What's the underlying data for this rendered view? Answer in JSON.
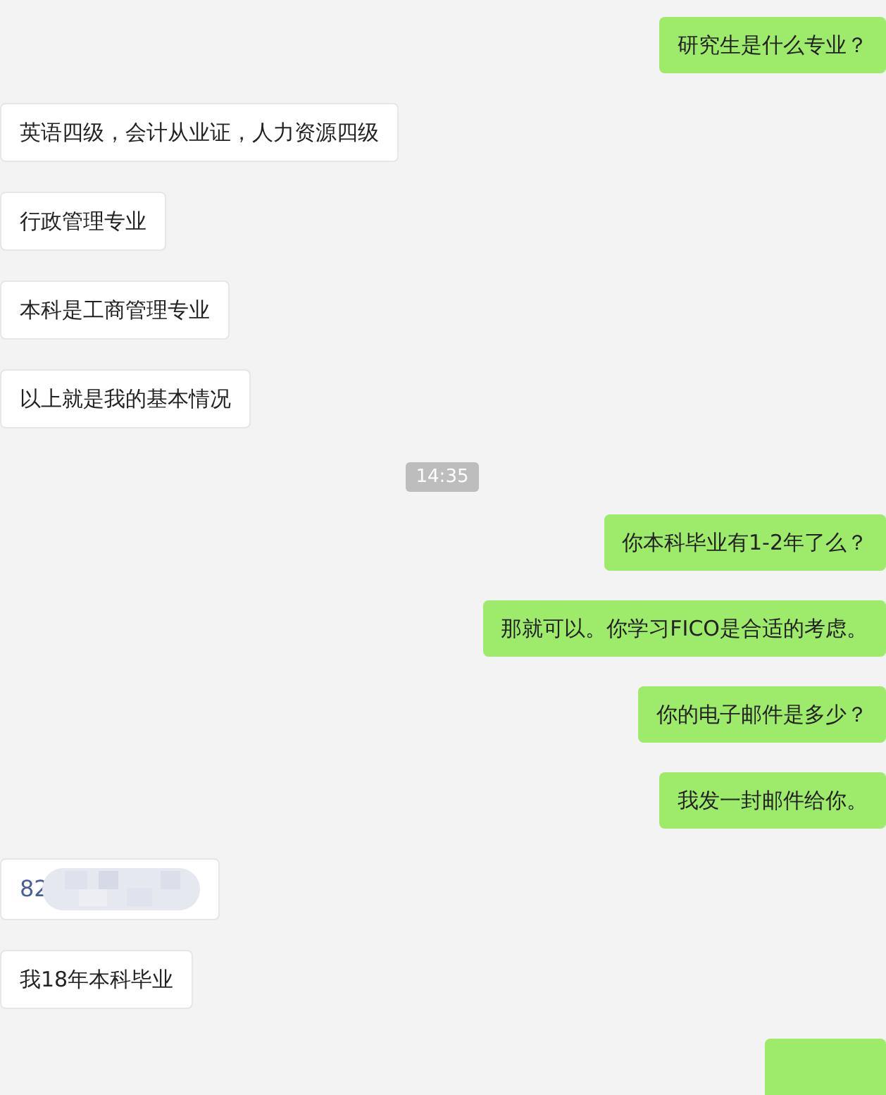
{
  "messages": [
    {
      "kind": "text",
      "outgoing": true,
      "text": "研究生是什么专业？"
    },
    {
      "kind": "text",
      "outgoing": false,
      "text": "英语四级，会计从业证，人力资源四级"
    },
    {
      "kind": "text",
      "outgoing": false,
      "text": "行政管理专业"
    },
    {
      "kind": "text",
      "outgoing": false,
      "text": "本科是工商管理专业"
    },
    {
      "kind": "text",
      "outgoing": false,
      "text": "以上就是我的基本情况"
    },
    {
      "kind": "time",
      "text": "14:35"
    },
    {
      "kind": "text",
      "outgoing": true,
      "text": "你本科毕业有1-2年了么？"
    },
    {
      "kind": "text",
      "outgoing": true,
      "text": "那就可以。你学习FICO是合适的考虑。"
    },
    {
      "kind": "text",
      "outgoing": true,
      "text": "你的电子邮件是多少？"
    },
    {
      "kind": "text",
      "outgoing": true,
      "text": "我发一封邮件给你。"
    },
    {
      "kind": "redacted",
      "outgoing": false,
      "text": "82"
    },
    {
      "kind": "text",
      "outgoing": false,
      "text": "我18年本科毕业"
    },
    {
      "kind": "obscured",
      "outgoing": true
    }
  ]
}
